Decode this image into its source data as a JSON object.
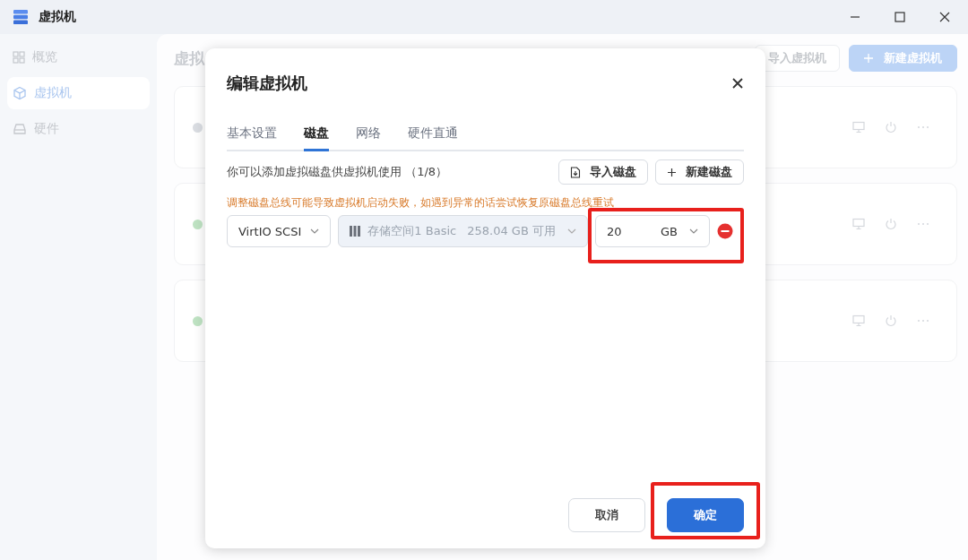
{
  "window": {
    "title": "虚拟机"
  },
  "sidebar": {
    "items": [
      {
        "label": "概览",
        "kind": "grid",
        "selected": false
      },
      {
        "label": "虚拟机",
        "kind": "cube",
        "selected": true
      },
      {
        "label": "硬件",
        "kind": "drive",
        "selected": false
      }
    ]
  },
  "main": {
    "title": "虚拟",
    "buttons": [
      {
        "label": "导入虚拟机",
        "kind": "secondary"
      },
      {
        "label": "新建虚拟机",
        "kind": "primary"
      }
    ],
    "vms": [
      {
        "color": "#dadde2"
      },
      {
        "color": "#bfe3c3"
      },
      {
        "color": "#bfe3c3"
      }
    ]
  },
  "dialog": {
    "title": "编辑虚拟机",
    "tabs": [
      {
        "label": "基本设置",
        "selected": false
      },
      {
        "label": "磁盘",
        "selected": true
      },
      {
        "label": "网络",
        "selected": false
      },
      {
        "label": "硬件直通",
        "selected": false
      }
    ],
    "description": "你可以添加虚拟磁盘供虚拟机使用 （1/8）",
    "actions": [
      {
        "label": "导入磁盘",
        "kind": "import"
      },
      {
        "label": "新建磁盘",
        "kind": "new"
      }
    ],
    "warning": "调整磁盘总线可能导致虚拟机启动失败，如遇到异常的话尝试恢复原磁盘总线重试",
    "disks": [
      {
        "bus": "VirtIO SCSI",
        "storage_name": "存储空间1 Basic",
        "storage_free": "258.04 GB 可用",
        "storage_disabled": true,
        "size": "20",
        "unit": "GB",
        "size_highlighted": true
      }
    ],
    "buttons": [
      {
        "label": "取消",
        "kind": "secondary",
        "highlighted": false
      },
      {
        "label": "确定",
        "kind": "primary",
        "highlighted": true
      }
    ]
  }
}
